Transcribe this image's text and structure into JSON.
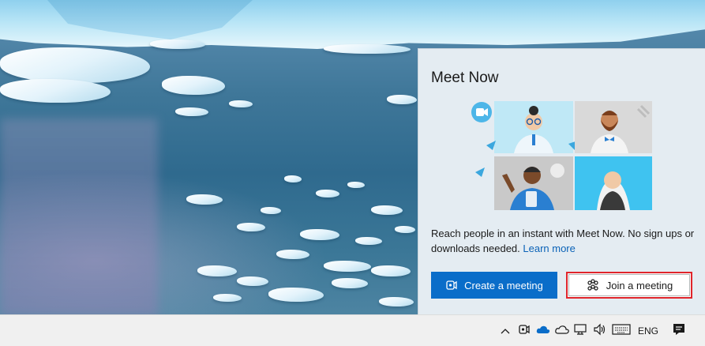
{
  "flyout": {
    "title": "Meet Now",
    "description": "Reach people in an instant with Meet Now. No sign ups or downloads needed.",
    "learn_more": "Learn more",
    "create_button": "Create a meeting",
    "join_button": "Join a meeting"
  },
  "taskbar": {
    "tray_icons": [
      "chevron-up-icon",
      "meet-now-icon",
      "onedrive-icon",
      "onedrive-personal-icon",
      "network-icon",
      "volume-icon",
      "keyboard-icon"
    ],
    "language": "ENG",
    "notification_icon": "action-center-icon"
  },
  "colors": {
    "accent": "#0a6dc9",
    "link": "#0a62b7",
    "highlight_border": "#e0252b",
    "flyout_bg": "#e4ecf2"
  }
}
